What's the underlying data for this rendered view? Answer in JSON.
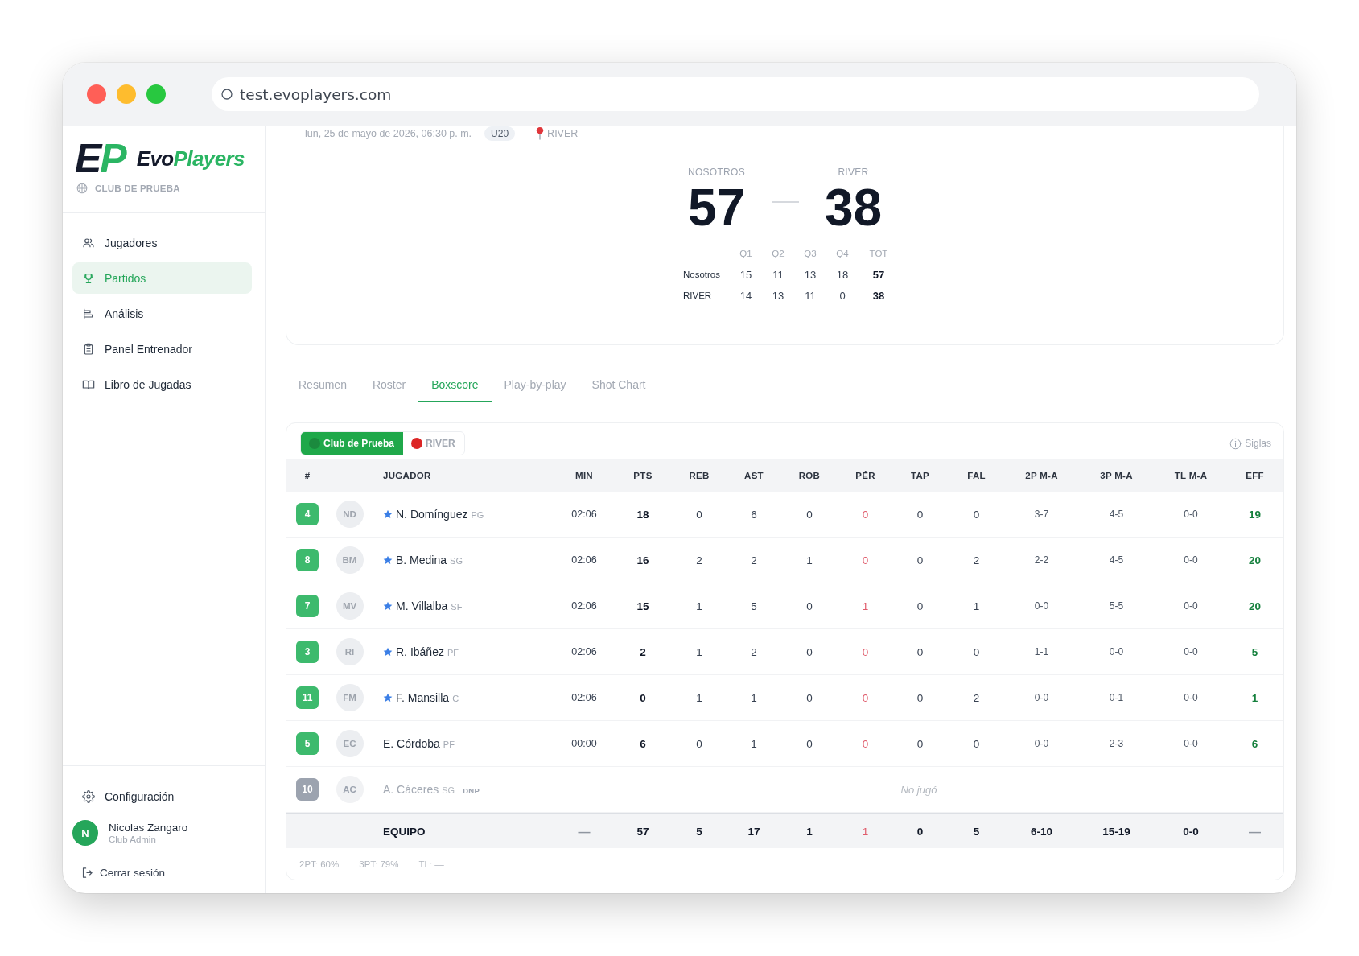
{
  "browser": {
    "url": "test.evoplayers.com"
  },
  "sidebar": {
    "brand": {
      "mark": [
        "E",
        "P"
      ],
      "name": [
        "Evo",
        "Players"
      ]
    },
    "club": "CLUB DE PRUEBA",
    "items": [
      {
        "label": "Jugadores",
        "selected": false
      },
      {
        "label": "Partidos",
        "selected": true
      },
      {
        "label": "Análisis",
        "selected": false
      },
      {
        "label": "Panel Entrenador",
        "selected": false
      },
      {
        "label": "Libro de Jugadas",
        "selected": false
      }
    ],
    "settings": "Configuración",
    "user": {
      "initial": "N",
      "name": "Nicolas Zangaro",
      "role": "Club Admin"
    },
    "logout": "Cerrar sesión"
  },
  "match": {
    "date": "lun, 25 de mayo de 2026, 06:30 p. m.",
    "category": "U20",
    "venue": "RIVER",
    "home": {
      "label": "NOSOTROS",
      "score": "57"
    },
    "away": {
      "label": "RIVER",
      "score": "38"
    },
    "periods": {
      "columns": [
        "Q1",
        "Q2",
        "Q3",
        "Q4",
        "TOT"
      ],
      "rows": [
        {
          "team": "Nosotros",
          "values": [
            "15",
            "11",
            "13",
            "18",
            "57"
          ]
        },
        {
          "team": "RIVER",
          "values": [
            "14",
            "13",
            "11",
            "0",
            "38"
          ]
        }
      ]
    }
  },
  "tabs": [
    {
      "label": "Resumen",
      "selected": false
    },
    {
      "label": "Roster",
      "selected": false
    },
    {
      "label": "Boxscore",
      "selected": true
    },
    {
      "label": "Play-by-play",
      "selected": false
    },
    {
      "label": "Shot Chart",
      "selected": false
    }
  ],
  "boxscore": {
    "teams": [
      {
        "label": "Club de Prueba",
        "color": "#1b8a3e",
        "selected": true
      },
      {
        "label": "RIVER",
        "color": "#dc2626",
        "selected": false
      }
    ],
    "legend": "Siglas",
    "columns": [
      "#",
      "JUGADOR",
      "MIN",
      "PTS",
      "REB",
      "AST",
      "ROB",
      "PÉR",
      "TAP",
      "FAL",
      "2P M-A",
      "3P M-A",
      "TL M-A",
      "EFF"
    ],
    "players": [
      {
        "number": "4",
        "initials": "ND",
        "starter": true,
        "name": "N. Domínguez",
        "position": "PG",
        "played": true,
        "stats": [
          "02:06",
          "18",
          "0",
          "6",
          "0",
          "0",
          "0",
          "0",
          "3-7",
          "4-5",
          "0-0",
          "19"
        ]
      },
      {
        "number": "8",
        "initials": "BM",
        "starter": true,
        "name": "B. Medina",
        "position": "SG",
        "played": true,
        "stats": [
          "02:06",
          "16",
          "2",
          "2",
          "1",
          "0",
          "0",
          "2",
          "2-2",
          "4-5",
          "0-0",
          "20"
        ]
      },
      {
        "number": "7",
        "initials": "MV",
        "starter": true,
        "name": "M. Villalba",
        "position": "SF",
        "played": true,
        "stats": [
          "02:06",
          "15",
          "1",
          "5",
          "0",
          "1",
          "0",
          "1",
          "0-0",
          "5-5",
          "0-0",
          "20"
        ]
      },
      {
        "number": "3",
        "initials": "RI",
        "starter": true,
        "name": "R. Ibáñez",
        "position": "PF",
        "played": true,
        "stats": [
          "02:06",
          "2",
          "1",
          "2",
          "0",
          "0",
          "0",
          "0",
          "1-1",
          "0-0",
          "0-0",
          "5"
        ]
      },
      {
        "number": "11",
        "initials": "FM",
        "starter": true,
        "name": "F. Mansilla",
        "position": "C",
        "played": true,
        "stats": [
          "02:06",
          "0",
          "1",
          "1",
          "0",
          "0",
          "0",
          "2",
          "0-0",
          "0-1",
          "0-0",
          "1"
        ]
      },
      {
        "number": "5",
        "initials": "EC",
        "starter": false,
        "name": "E. Córdoba",
        "position": "PF",
        "played": true,
        "stats": [
          "00:00",
          "6",
          "0",
          "1",
          "0",
          "0",
          "0",
          "0",
          "0-0",
          "2-3",
          "0-0",
          "6"
        ]
      },
      {
        "number": "10",
        "initials": "AC",
        "starter": false,
        "name": "A. Cáceres",
        "position": "SG",
        "played": false,
        "tag": "DNP",
        "note": "No jugó"
      }
    ],
    "totals": {
      "label": "EQUIPO",
      "stats": [
        "—",
        "57",
        "5",
        "17",
        "1",
        "1",
        "0",
        "5",
        "6-10",
        "15-19",
        "0-0",
        "—"
      ]
    },
    "shooting": [
      "2PT: 60%",
      "3PT: 79%",
      "TL: —"
    ]
  }
}
